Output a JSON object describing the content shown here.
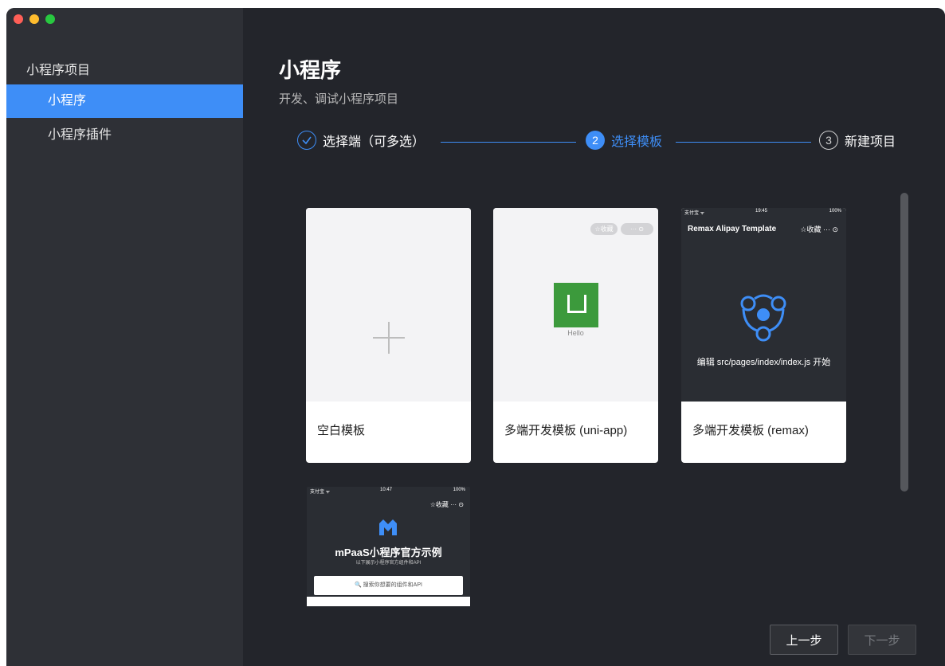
{
  "sidebar": {
    "section_title": "小程序项目",
    "items": [
      {
        "label": "小程序",
        "active": true
      },
      {
        "label": "小程序插件",
        "active": false
      }
    ]
  },
  "header": {
    "title": "小程序",
    "subtitle": "开发、调试小程序项目"
  },
  "steps": [
    {
      "index": "✓",
      "label": "选择端（可多选）",
      "state": "done"
    },
    {
      "index": "2",
      "label": "选择模板",
      "state": "active"
    },
    {
      "index": "3",
      "label": "新建项目",
      "state": "pending"
    }
  ],
  "templates": [
    {
      "label": "空白模板"
    },
    {
      "label": "多端开发模板 (uni-app)",
      "preview_text": "Hello",
      "pills": [
        "☆收藏",
        "··· ⊙"
      ]
    },
    {
      "label": "多端开发模板 (remax)",
      "status_left": "支付宝 ᯤ",
      "status_time": "19:45",
      "status_right": "100%",
      "preview_title": "Remax Alipay Template",
      "preview_extra": "☆收藏  ···  ⊙",
      "preview_hint": "编辑 src/pages/index/index.js 开始"
    },
    {
      "status_left": "支付宝 ᯤ",
      "status_time": "10:47",
      "status_right": "100%",
      "preview_extra": "☆收藏  ···  ⊙",
      "preview_title": "mPaaS小程序官方示例",
      "preview_sub": "以下展示小程序官方组件和API",
      "preview_search": "🔍 搜索你想要的组件和API"
    }
  ],
  "buttons": {
    "prev": "上一步",
    "next": "下一步"
  },
  "colors": {
    "accent": "#3e8ef7",
    "background": "#23252b",
    "sidebar": "#2e3036"
  }
}
